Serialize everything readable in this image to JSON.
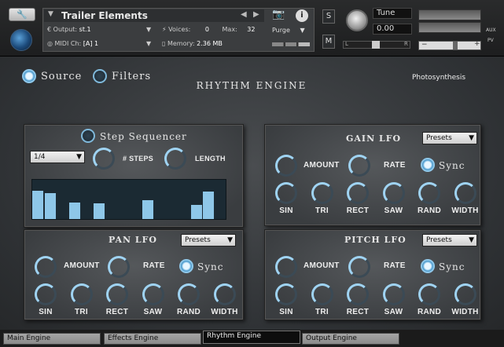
{
  "header": {
    "instrument_title": "Trailer Elements",
    "output_label": "Output:",
    "output_value": "st.1",
    "voices_label": "Voices:",
    "voices_value": "0",
    "max_label": "Max:",
    "max_value": "32",
    "midi_label": "MIDI Ch:",
    "midi_value": "[A]  1",
    "memory_label": "Memory:",
    "memory_value": "2.36 MB",
    "purge_label": "Purge",
    "tune_label": "Tune",
    "tune_value": "0.00",
    "s_label": "S",
    "m_label": "M",
    "l_label": "L",
    "r_label": "R",
    "aux_label": "AUX",
    "pv_label": "PV",
    "minus": "−",
    "plus": "+"
  },
  "main": {
    "source_label": "Source",
    "filters_label": "Filters",
    "page_title": "Rhythm Engine",
    "patch_name": "Photosynthesis"
  },
  "step_seq": {
    "title": "Step Sequencer",
    "rate": "1/4",
    "steps_label": "# STEPS",
    "length_label": "LENGTH",
    "levels": [
      0.72,
      0.67,
      0,
      0.43,
      0,
      0.41,
      0,
      0,
      0,
      0.49,
      0,
      0,
      0,
      0.37,
      0.71,
      0
    ]
  },
  "gain_lfo": {
    "title": "Gain LFO",
    "presets": "Presets",
    "amount": "AMOUNT",
    "rate": "RATE",
    "sync": "Sync",
    "sin": "SIN",
    "tri": "TRI",
    "rect": "RECT",
    "saw": "SAW",
    "rand": "RAND",
    "width": "WIDTH"
  },
  "pan_lfo": {
    "title": "Pan LFO",
    "presets": "Presets",
    "amount": "AMOUNT",
    "rate": "RATE",
    "sync": "Sync",
    "sin": "SIN",
    "tri": "TRI",
    "rect": "RECT",
    "saw": "SAW",
    "rand": "RAND",
    "width": "WIDTH"
  },
  "pitch_lfo": {
    "title": "Pitch LFO",
    "presets": "Presets",
    "amount": "AMOUNT",
    "rate": "RATE",
    "sync": "Sync",
    "sin": "SIN",
    "tri": "TRI",
    "rect": "RECT",
    "saw": "SAW",
    "rand": "RAND",
    "width": "WIDTH"
  },
  "tabs": [
    "Main Engine",
    "Effects Engine",
    "Rhythm Engine",
    "Output Engine"
  ],
  "active_tab": "Rhythm Engine"
}
